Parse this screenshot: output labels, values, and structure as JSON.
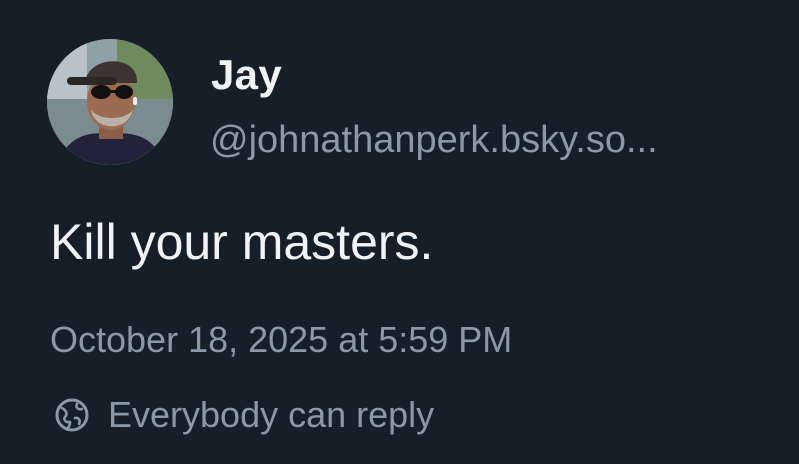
{
  "author": {
    "display_name": "Jay",
    "handle": "@johnathanperk.bsky.so..."
  },
  "post": {
    "text": "Kill your masters.",
    "timestamp": "October 18, 2025 at 5:59 PM"
  },
  "reply_setting": {
    "label": "Everybody can reply",
    "icon": "globe-icon"
  },
  "colors": {
    "background": "#161e27",
    "primary_text": "#f1f3f5",
    "secondary_text": "#8b98a6"
  }
}
